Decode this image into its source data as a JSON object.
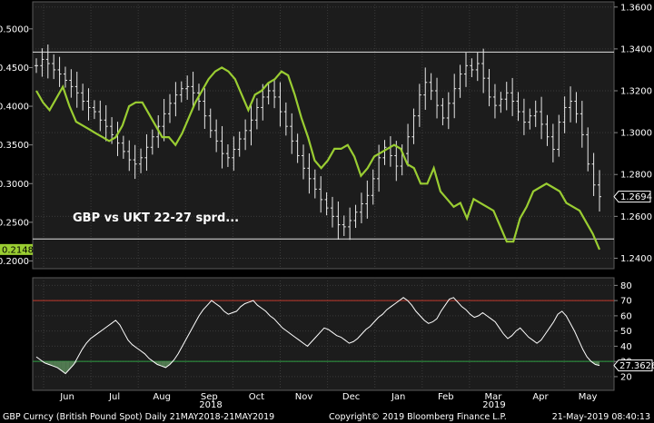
{
  "chart_data": [
    {
      "type": "ohlc+line",
      "annotation": "GBP vs UKT 22-27 sprd...",
      "left_ticks": [
        "0.5000",
        "0.4500",
        "0.4000",
        "0.3500",
        "0.3000",
        "0.2500",
        "0.2000"
      ],
      "right_ticks": [
        "1.3600",
        "1.3400",
        "1.3200",
        "1.3000",
        "1.2800",
        "1.2600",
        "1.2400"
      ],
      "left_ylim": [
        0.19,
        0.535
      ],
      "right_ylim": [
        1.235,
        1.3625
      ],
      "reference_lines": {
        "upper": 1.3385,
        "lower": 1.2492
      },
      "last_price": "1.2694",
      "last_spread": "0.2148",
      "series": [
        {
          "name": "GBP Curncy",
          "axis": "right",
          "color": "#ffffff",
          "values": [
            1.332,
            1.335,
            1.333,
            1.33,
            1.328,
            1.325,
            1.322,
            1.319,
            1.315,
            1.312,
            1.31,
            1.306,
            1.303,
            1.299,
            1.295,
            1.291,
            1.287,
            1.285,
            1.288,
            1.293,
            1.298,
            1.303,
            1.309,
            1.314,
            1.318,
            1.321,
            1.322,
            1.319,
            1.315,
            1.308,
            1.301,
            1.296,
            1.29,
            1.288,
            1.292,
            1.297,
            1.301,
            1.306,
            1.312,
            1.317,
            1.32,
            1.317,
            1.31,
            1.303,
            1.296,
            1.289,
            1.283,
            1.278,
            1.273,
            1.268,
            1.264,
            1.26,
            1.256,
            1.255,
            1.258,
            1.262,
            1.266,
            1.27,
            1.278,
            1.288,
            1.293,
            1.289,
            1.284,
            1.29,
            1.298,
            1.308,
            1.318,
            1.324,
            1.32,
            1.313,
            1.307,
            1.314,
            1.321,
            1.328,
            1.332,
            1.33,
            1.333,
            1.326,
            1.317,
            1.313,
            1.316,
            1.319,
            1.315,
            1.31,
            1.305,
            1.308,
            1.31,
            1.304,
            1.298,
            1.292,
            1.305,
            1.312,
            1.315,
            1.309,
            1.299,
            1.285,
            1.275,
            1.2694
          ]
        },
        {
          "name": "GBP vs UKT 22-27 sprd",
          "axis": "left",
          "color": "#9acd32",
          "values": [
            0.42,
            0.405,
            0.395,
            0.41,
            0.425,
            0.4,
            0.38,
            0.375,
            0.37,
            0.365,
            0.36,
            0.355,
            0.36,
            0.375,
            0.4,
            0.405,
            0.405,
            0.39,
            0.375,
            0.36,
            0.36,
            0.35,
            0.365,
            0.385,
            0.405,
            0.42,
            0.435,
            0.445,
            0.45,
            0.445,
            0.435,
            0.415,
            0.395,
            0.415,
            0.42,
            0.43,
            0.435,
            0.445,
            0.44,
            0.415,
            0.385,
            0.36,
            0.33,
            0.32,
            0.33,
            0.345,
            0.345,
            0.35,
            0.335,
            0.31,
            0.32,
            0.335,
            0.34,
            0.345,
            0.35,
            0.345,
            0.325,
            0.32,
            0.3,
            0.3,
            0.32,
            0.29,
            0.28,
            0.27,
            0.275,
            0.255,
            0.28,
            0.275,
            0.27,
            0.265,
            0.245,
            0.225,
            0.225,
            0.255,
            0.27,
            0.29,
            0.295,
            0.3,
            0.295,
            0.29,
            0.275,
            0.27,
            0.265,
            0.25,
            0.235,
            0.2148
          ]
        }
      ]
    },
    {
      "type": "line",
      "indicator_value": "27.3626",
      "ticks": [
        "80",
        "70",
        "60",
        "50",
        "40",
        "30",
        "20"
      ],
      "ylim": [
        11,
        85
      ],
      "overbought": 70,
      "oversold": 30,
      "series": [
        {
          "color": "#ffffff",
          "values": [
            33,
            31,
            29,
            28,
            27,
            26,
            24,
            22,
            25,
            28,
            33,
            38,
            42,
            45,
            47,
            49,
            51,
            53,
            55,
            57,
            54,
            49,
            44,
            41,
            39,
            37,
            35,
            32,
            30,
            28,
            27,
            26,
            28,
            31,
            35,
            40,
            45,
            50,
            55,
            60,
            64,
            67,
            70,
            68,
            66,
            63,
            61,
            62,
            63,
            66,
            68,
            69,
            70,
            67,
            65,
            63,
            60,
            58,
            55,
            52,
            50,
            48,
            46,
            44,
            42,
            40,
            43,
            46,
            49,
            52,
            51,
            49,
            47,
            46,
            44,
            42,
            43,
            45,
            48,
            51,
            53,
            56,
            59,
            61,
            64,
            66,
            68,
            70,
            72,
            70,
            67,
            63,
            60,
            57,
            55,
            56,
            58,
            63,
            67,
            71,
            72,
            69,
            66,
            64,
            61,
            59,
            60,
            62,
            60,
            58,
            56,
            52,
            48,
            45,
            47,
            50,
            52,
            49,
            46,
            44,
            42,
            44,
            48,
            52,
            56,
            61,
            63,
            60,
            55,
            50,
            44,
            38,
            33,
            30,
            28,
            27.36
          ]
        }
      ]
    }
  ],
  "x_axis": {
    "months": [
      "Jun",
      "Jul",
      "Aug",
      "Sep",
      "Oct",
      "Nov",
      "Dec",
      "Jan",
      "Feb",
      "Mar",
      "Apr",
      "May"
    ],
    "year_2018": "2018",
    "year_2019": "2019"
  },
  "footer": {
    "left": "GBP Curncy (British Pound Spot)  Daily 21MAY2018-21MAY2019",
    "center": "Copyright© 2019 Bloomberg Finance L.P.",
    "right": "21-May-2019 08:40:13"
  }
}
